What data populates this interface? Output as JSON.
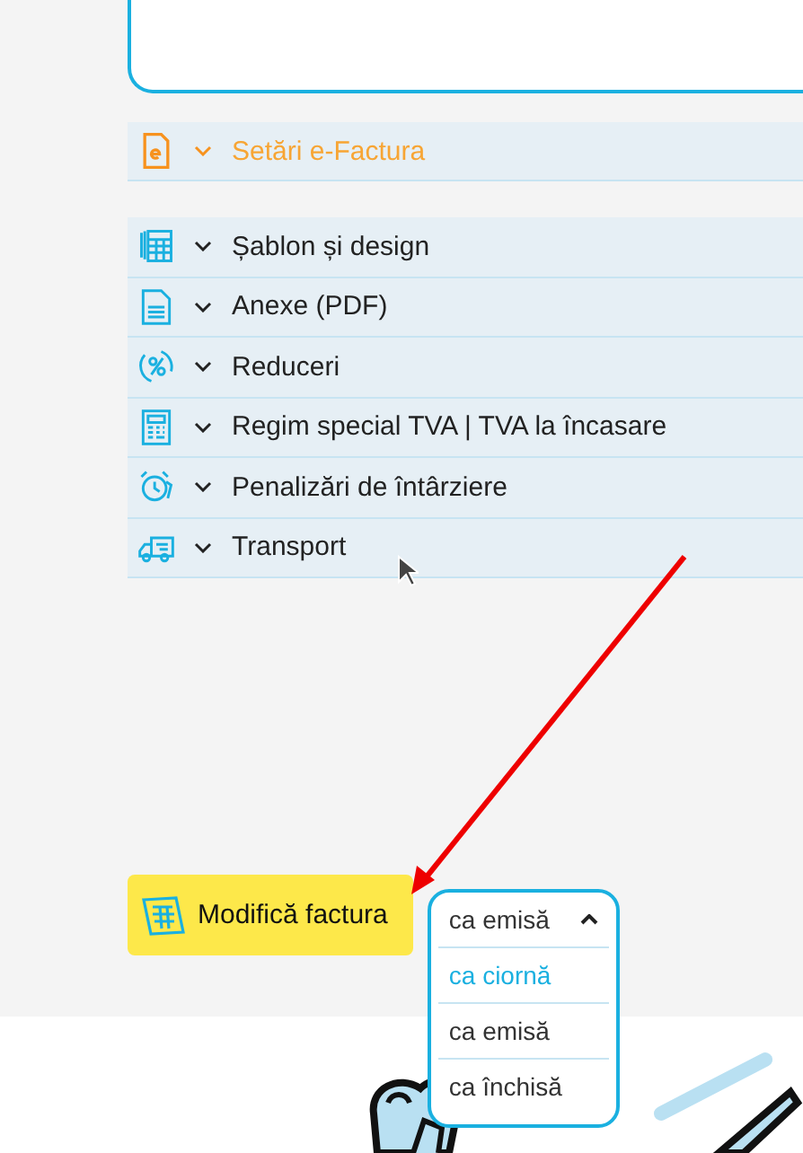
{
  "efactura_section": {
    "label": "Setări e-Factura",
    "expanded": false
  },
  "settings_sections": [
    {
      "kind": "spreadsheet",
      "label": "Șablon și design",
      "expanded": false
    },
    {
      "kind": "pdf",
      "label": "Anexe (PDF)",
      "expanded": false
    },
    {
      "kind": "percent",
      "label": "Reduceri",
      "expanded": false
    },
    {
      "kind": "calculator",
      "label": "Regim special TVA | TVA la încasare",
      "expanded": false
    },
    {
      "kind": "alarm",
      "label": "Penalizări de întârziere",
      "expanded": false
    },
    {
      "kind": "truck",
      "label": "Transport",
      "expanded": false
    }
  ],
  "modify_button": {
    "label": "Modifică factura"
  },
  "status_dropdown": {
    "value": "ca emisă",
    "expanded": true,
    "options": [
      {
        "label": "ca ciornă",
        "hovered": true
      },
      {
        "label": "ca emisă",
        "hovered": false
      },
      {
        "label": "ca închisă",
        "hovered": false
      }
    ]
  }
}
